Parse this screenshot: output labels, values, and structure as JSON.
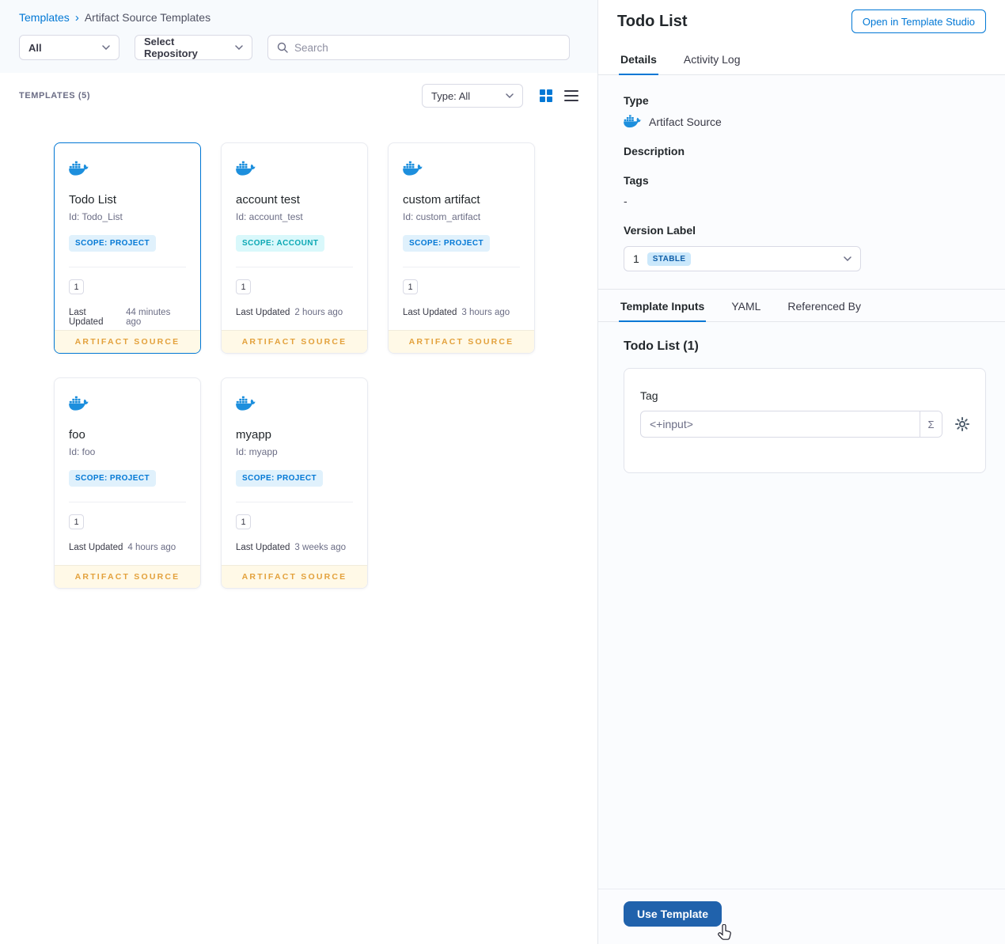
{
  "colors": {
    "primary_blue": "#0278d5",
    "docker_blue": "#1d8fdd",
    "selected_card_border": "#0278d5",
    "scope_project_text": "#0278d5",
    "scope_project_bg": "#e0f1fc",
    "scope_account_text": "#0ba8b4",
    "scope_account_bg": "#d9f8fb",
    "artifact_source_text": "#e3a13c",
    "artifact_source_bg": "#fff9e7",
    "stable_badge_bg": "#cbe8fb",
    "stable_badge_text": "#0f5ea8",
    "use_template_button_bg": "#2062ac"
  },
  "breadcrumb": {
    "root": "Templates",
    "separator": "›",
    "current": "Artifact Source Templates"
  },
  "filters": {
    "scope_dropdown": "All",
    "repository_dropdown": "Select Repository",
    "search_placeholder": "Search"
  },
  "list_header": {
    "count_label": "TEMPLATES (5)",
    "type_dropdown": "Type: All"
  },
  "cards": [
    {
      "name": "Todo List",
      "id": "Id: Todo_List",
      "scope": "SCOPE: PROJECT",
      "scope_type": "project",
      "version": "1",
      "updated_label": "Last Updated",
      "updated": "44 minutes ago",
      "footer": "ARTIFACT SOURCE",
      "selected": true
    },
    {
      "name": "account test",
      "id": "Id: account_test",
      "scope": "SCOPE: ACCOUNT",
      "scope_type": "account",
      "version": "1",
      "updated_label": "Last Updated",
      "updated": "2 hours ago",
      "footer": "ARTIFACT SOURCE",
      "selected": false
    },
    {
      "name": "custom artifact",
      "id": "Id: custom_artifact",
      "scope": "SCOPE: PROJECT",
      "scope_type": "project",
      "version": "1",
      "updated_label": "Last Updated",
      "updated": "3 hours ago",
      "footer": "ARTIFACT SOURCE",
      "selected": false
    },
    {
      "name": "foo",
      "id": "Id: foo",
      "scope": "SCOPE: PROJECT",
      "scope_type": "project",
      "version": "1",
      "updated_label": "Last Updated",
      "updated": "4 hours ago",
      "footer": "ARTIFACT SOURCE",
      "selected": false
    },
    {
      "name": "myapp",
      "id": "Id: myapp",
      "scope": "SCOPE: PROJECT",
      "scope_type": "project",
      "version": "1",
      "updated_label": "Last Updated",
      "updated": "3 weeks ago",
      "footer": "ARTIFACT SOURCE",
      "selected": false
    }
  ],
  "details": {
    "title": "Todo List",
    "open_in_studio_button": "Open in Template Studio",
    "tabs": [
      "Details",
      "Activity Log"
    ],
    "fields": {
      "type_label": "Type",
      "type_value": "Artifact Source",
      "description_label": "Description",
      "tags_label": "Tags",
      "tags_value": "-",
      "version_label": "Version Label",
      "version_value": "1",
      "version_badge": "STABLE"
    },
    "inputs": {
      "tabs": [
        "Template Inputs",
        "YAML",
        "Referenced By"
      ],
      "section_title": "Todo List (1)",
      "tag_label": "Tag",
      "tag_value": "<+input>",
      "expression_symbol": "Σ"
    },
    "use_template_button": "Use Template"
  }
}
